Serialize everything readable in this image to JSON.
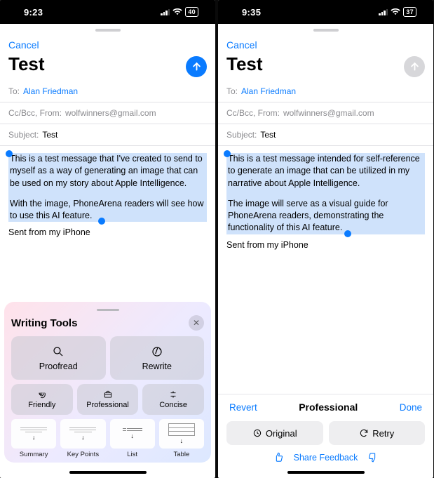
{
  "left": {
    "status_time": "9:23",
    "battery": "40",
    "cancel": "Cancel",
    "title": "Test",
    "to_label": "To:",
    "to_value": "Alan Friedman",
    "ccbcc": "Cc/Bcc, From:",
    "from_value": "wolfwinners@gmail.com",
    "subject_label": "Subject:",
    "subject_value": "Test",
    "body_p1": "This is a test message that I've created to send to myself as a way of generating an image that can be used on my story about Apple Intelligence.",
    "body_p2": "With the image, PhoneArena readers will see how to use this AI feature.",
    "signature": "Sent from my iPhone",
    "wt_title": "Writing Tools",
    "wt_close": "✕",
    "wt_proofread": "Proofread",
    "wt_rewrite": "Rewrite",
    "wt_friendly": "Friendly",
    "wt_professional": "Professional",
    "wt_concise": "Concise",
    "wt_summary": "Summary",
    "wt_keypoints": "Key Points",
    "wt_list": "List",
    "wt_table": "Table"
  },
  "right": {
    "status_time": "9:35",
    "battery": "37",
    "cancel": "Cancel",
    "title": "Test",
    "to_label": "To:",
    "to_value": "Alan Friedman",
    "ccbcc": "Cc/Bcc, From:",
    "from_value": "wolfwinners@gmail.com",
    "subject_label": "Subject:",
    "subject_value": "Test",
    "body_p1": "This is a test message intended for self-reference to generate an image that can be utilized in my narrative about Apple Intelligence.",
    "body_p2": "The image will serve as a visual guide for PhoneArena readers, demonstrating the functionality of this AI feature.",
    "signature": "Sent from my iPhone",
    "revert": "Revert",
    "mode": "Professional",
    "done": "Done",
    "original": "Original",
    "retry": "Retry",
    "share": "Share Feedback"
  }
}
